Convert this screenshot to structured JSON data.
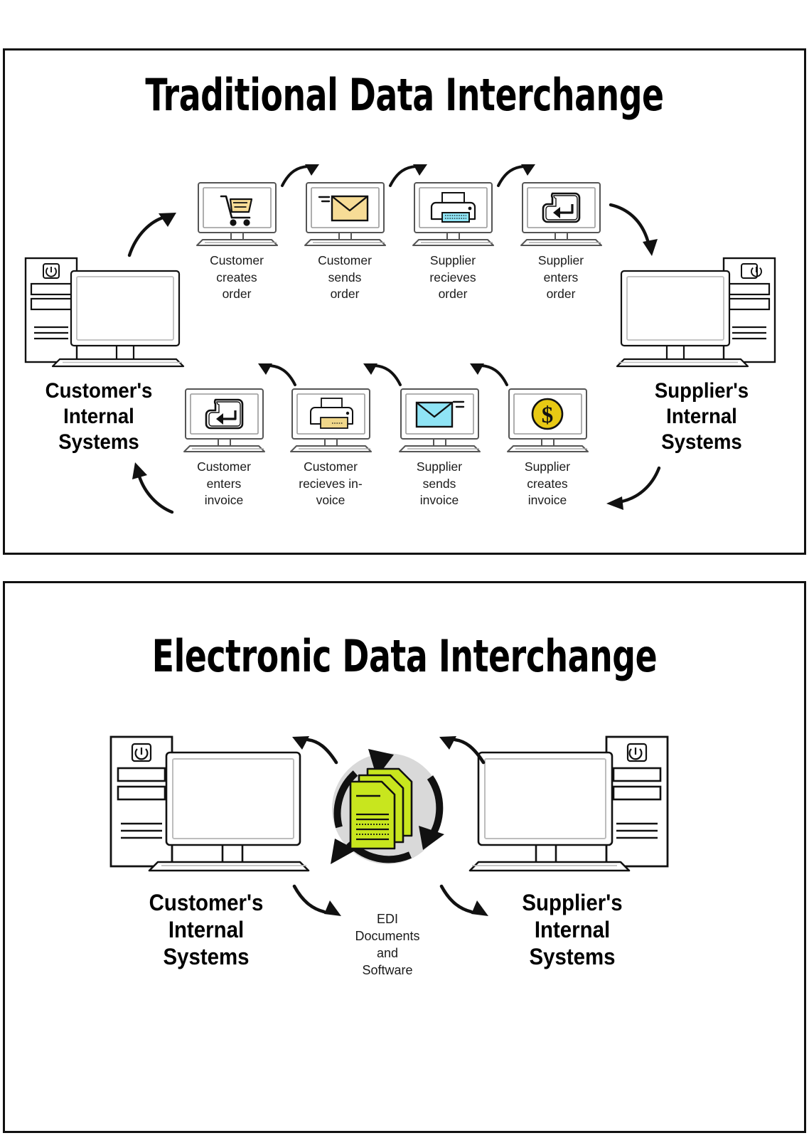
{
  "panels": {
    "traditional": {
      "title": "Traditional Data Interchange",
      "left_system": {
        "label": "Customer's\nInternal\nSystems",
        "icon": "desktop-computer-icon"
      },
      "right_system": {
        "label": "Supplier's\nInternal\nSystems",
        "icon": "desktop-computer-icon"
      },
      "top_steps": [
        {
          "label": "Customer\ncreates\norder",
          "icon": "shopping-cart-icon",
          "color": "#F7DC96"
        },
        {
          "label": "Customer\nsends\norder",
          "icon": "envelope-icon",
          "color": "#F7DC96"
        },
        {
          "label": "Supplier\nrecieves\norder",
          "icon": "printer-icon",
          "color": "#8FE4F5"
        },
        {
          "label": "Supplier\nenters\norder",
          "icon": "enter-key-icon",
          "color": "#ffffff"
        }
      ],
      "bottom_steps": [
        {
          "label": "Customer\nenters\ninvoice",
          "icon": "enter-key-icon",
          "color": "#ffffff"
        },
        {
          "label": "Customer\nrecieves in-\nvoice",
          "icon": "printer-icon",
          "color": "#F0D78A"
        },
        {
          "label": "Supplier\nsends\ninvoice",
          "icon": "envelope-icon",
          "color": "#8FE4F5"
        },
        {
          "label": "Supplier\ncreates\ninvoice",
          "icon": "dollar-coin-icon",
          "color": "#E8C914"
        }
      ]
    },
    "electronic": {
      "title": "Electronic Data Interchange",
      "left_system": {
        "label": "Customer's\nInternal\nSystems",
        "icon": "desktop-computer-icon"
      },
      "right_system": {
        "label": "Supplier's\nInternal\nSystems",
        "icon": "desktop-computer-icon"
      },
      "hub": {
        "label": "EDI\nDocuments\nand\nSoftware",
        "icon": "edi-documents-icon",
        "document_color": "#C8E61E",
        "circle_color": "#D9D9D9"
      }
    }
  },
  "colors": {
    "outline": "#111111",
    "yellow": "#F7DC96",
    "cyan": "#8FE4F5",
    "gold": "#E8C914",
    "lime": "#C8E61E",
    "grey_circle": "#D9D9D9",
    "background": "#ffffff"
  }
}
